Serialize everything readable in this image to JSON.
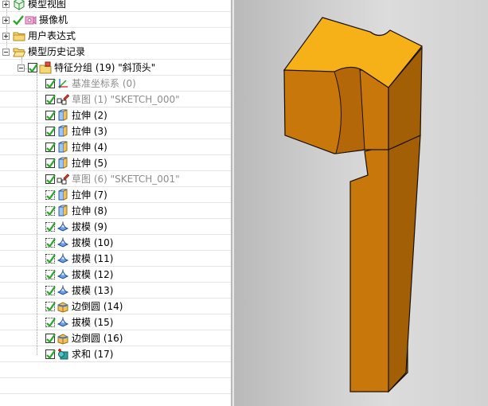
{
  "navigator": {
    "rows": [
      {
        "label": "模型视图",
        "icon": "model-views-icon"
      },
      {
        "label": "摄像机",
        "icon": "camera-icon"
      },
      {
        "label": "用户表达式",
        "icon": "folder-icon"
      },
      {
        "label": "模型历史记录",
        "icon": "folder-icon"
      },
      {
        "label": "特征分组 (19) \"斜顶头\"",
        "icon": "feature-group-folder-icon"
      },
      {
        "label": "基准坐标系 (0)",
        "icon": "datum-csys-icon"
      },
      {
        "label": "草图 (1) \"SKETCH_000\"",
        "icon": "sketch-icon"
      },
      {
        "label": "拉伸 (2)",
        "icon": "extrude-icon"
      },
      {
        "label": "拉伸 (3)",
        "icon": "extrude-icon"
      },
      {
        "label": "拉伸 (4)",
        "icon": "extrude-icon"
      },
      {
        "label": "拉伸 (5)",
        "icon": "extrude-icon"
      },
      {
        "label": "草图 (6) \"SKETCH_001\"",
        "icon": "sketch-icon"
      },
      {
        "label": "拉伸 (7)",
        "icon": "extrude-icon"
      },
      {
        "label": "拉伸 (8)",
        "icon": "extrude-icon"
      },
      {
        "label": "拔模 (9)",
        "icon": "draft-icon"
      },
      {
        "label": "拔模 (10)",
        "icon": "draft-icon"
      },
      {
        "label": "拔模 (11)",
        "icon": "draft-icon"
      },
      {
        "label": "拔模 (12)",
        "icon": "draft-icon"
      },
      {
        "label": "拔模 (13)",
        "icon": "draft-icon"
      },
      {
        "label": "边倒圆 (14)",
        "icon": "edge-blend-icon"
      },
      {
        "label": "拔模 (15)",
        "icon": "draft-icon"
      },
      {
        "label": "边倒圆 (16)",
        "icon": "edge-blend-icon"
      },
      {
        "label": "求和 (17)",
        "icon": "unite-icon"
      }
    ]
  },
  "colors": {
    "model_top": "#f5b117",
    "model_front": "#c8780a",
    "model_side": "#a35f05",
    "model_edge": "#1a1000",
    "check_green": "#2aa52a",
    "viewport_background": "#cfcfcf"
  }
}
